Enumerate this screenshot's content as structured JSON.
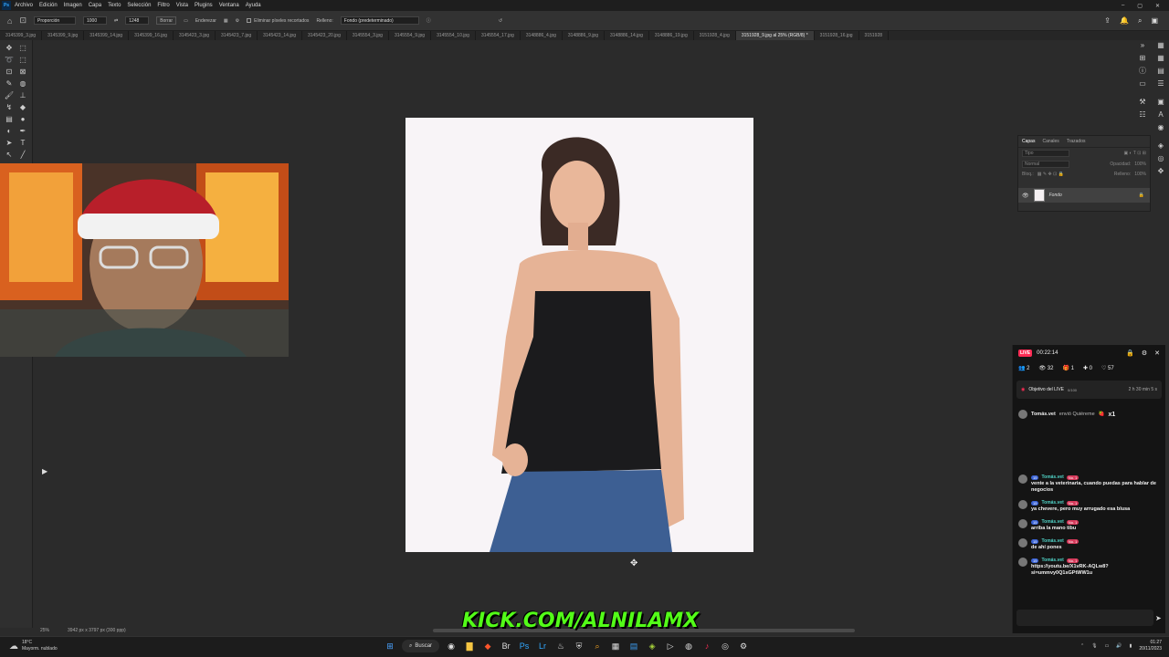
{
  "menu": {
    "app_logo": "Ps",
    "items": [
      "Archivo",
      "Edición",
      "Imagen",
      "Capa",
      "Texto",
      "Selección",
      "Filtro",
      "Vista",
      "Plugins",
      "Ventana",
      "Ayuda"
    ]
  },
  "options": {
    "ratio_label": "Proporción",
    "width_value": "1000",
    "height_value": "1248",
    "clear_label": "Borrar",
    "straighten_label": "Enderezar",
    "delete_cropped_label": "Eliminar píxeles recortados",
    "fill_label": "Relleno:",
    "fill_value": "Fondo (predeterminado)"
  },
  "tabs": [
    "3145399_3.jpg",
    "3145399_9.jpg",
    "3145399_14.jpg",
    "3145399_16.jpg",
    "3145423_3.jpg",
    "3145423_7.jpg",
    "3145423_14.jpg",
    "3145423_20.jpg",
    "3145554_3.jpg",
    "3145554_9.jpg",
    "3145554_10.jpg",
    "3145554_17.jpg",
    "3148886_4.jpg",
    "3148886_9.jpg",
    "3148886_14.jpg",
    "3148886_19.jpg",
    "3151928_4.jpg",
    "3151928_9.jpg al 25% (RGB/8) *",
    "3151928_16.jpg",
    "3151928"
  ],
  "active_tab_index": 17,
  "layers_panel": {
    "tabs": [
      "Capas",
      "Canales",
      "Trazados"
    ],
    "search_placeholder": "Tipo",
    "blend_mode": "Normal",
    "opacity_label": "Opacidad:",
    "opacity_value": "100%",
    "lock_label": "Bloq.:",
    "fill_label": "Relleno:",
    "fill_value": "100%",
    "layer_name": "Fondo"
  },
  "status": {
    "zoom": "25%",
    "doc_info": "3942 px x 3797 px (300 ppp)"
  },
  "live": {
    "badge": "LIVE",
    "timer": "00:22:14",
    "stats": [
      "2",
      "32",
      "1",
      "0",
      "57"
    ],
    "goal_title": "Objetivo del LIVE",
    "goal_progress": "0/100",
    "goal_time": "2 h 30 min 5 s",
    "gift_user": "Tomás.vet",
    "gift_text": "envió Quiéreme",
    "gift_count": "x1",
    "messages": [
      {
        "user": "Tomás.vet",
        "level": "15",
        "rank": "No. 1",
        "text": "vente a la veterinaria, cuando puedas para hablar de negocios"
      },
      {
        "user": "Tomás.vet",
        "level": "15",
        "rank": "No. 1",
        "text": "ya chevere, pero muy arrugado esa blusa"
      },
      {
        "user": "Tomás.vet",
        "level": "15",
        "rank": "No. 1",
        "text": "arriba la mano tibu"
      },
      {
        "user": "Tomás.vet",
        "level": "15",
        "rank": "No. 1",
        "text": "de ahí pones"
      },
      {
        "user": "Tomás.vet",
        "level": "15",
        "rank": "No. 1",
        "text": "https://youtu.be/X1vRK-AQLw8?si=ummvy0Q1sGPtWW1u"
      }
    ]
  },
  "overlay": {
    "kick_text": "KICK.COM/ALNILAMX"
  },
  "taskbar": {
    "temp": "18°C",
    "weather": "Mayorm. nublado",
    "search_label": "Buscar",
    "time": "01:27",
    "date": "20/11/2023"
  }
}
